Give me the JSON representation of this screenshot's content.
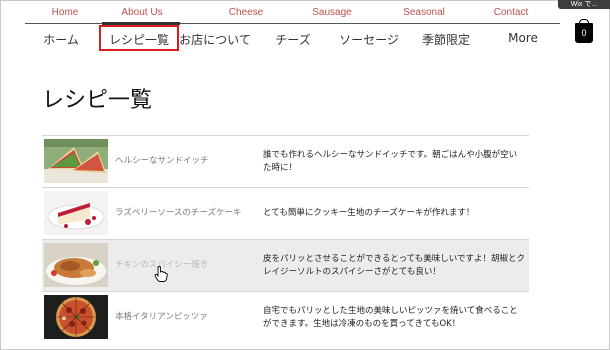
{
  "top_nav": {
    "items": [
      "Home",
      "About Us",
      "Cheese",
      "Sausage",
      "Seasonal",
      "Contact"
    ],
    "active": "About Us",
    "color": "#c0504d"
  },
  "wix_badge": {
    "label": "Wix で..."
  },
  "main_nav": {
    "items": [
      "ホーム",
      "レシピ一覧",
      "お店について",
      "チーズ",
      "ソーセージ",
      "季節限定",
      "More"
    ],
    "highlighted": "レシピ一覧",
    "highlight_color": "#d81e1e"
  },
  "cart": {
    "count": "0",
    "icon": "shopping-bag-icon"
  },
  "page": {
    "title": "レシピ一覧"
  },
  "recipes": [
    {
      "name": "ヘルシーなサンドイッチ",
      "description": "誰でも作れるヘルシーなサンドイッチです。朝ごはんや小腹が空いた時に！",
      "image": "sandwich-image"
    },
    {
      "name": "ラズベリーソースのチーズケーキ",
      "description": "とても簡単にクッキー生地のチーズケーキが作れます！",
      "image": "cheesecake-image"
    },
    {
      "name": "チキンのスパイシー焼き",
      "description": "皮をパリッとさせることができるとっても美味しいですよ！胡椒とクレイジーソルトのスパイシーさがとても良い！",
      "image": "spicy-chicken-image"
    },
    {
      "name": "本格イタリアンピッツァ",
      "description": "自宅でもパリッとした生地の美味しいピッツァを焼いて食べることができます。生地は冷凍のものを買ってきてもOK！",
      "image": "pizza-image"
    }
  ],
  "hovered_recipe": 2
}
